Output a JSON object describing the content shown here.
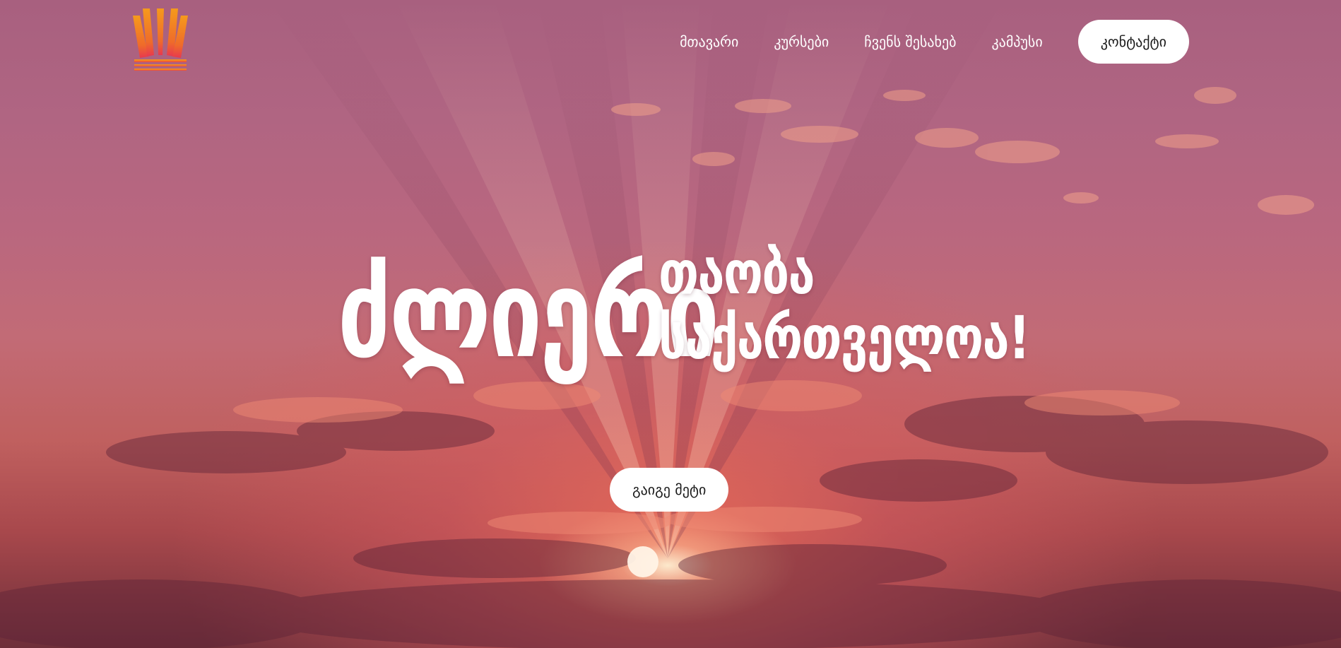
{
  "nav": {
    "items": [
      {
        "label": "მთავარი"
      },
      {
        "label": "კურსები"
      },
      {
        "label": "ჩვენს შესახებ"
      },
      {
        "label": "კამპუსი"
      }
    ],
    "contact_label": "კონტაქტი"
  },
  "hero": {
    "headline_big": "ძლიერი",
    "headline_line1": "თაობა",
    "headline_line2": "საქართველოა!",
    "cta_label": "გაიგე მეტი"
  },
  "colors": {
    "logo_orange": "#f28a1e",
    "logo_red": "#e8384f",
    "button_bg": "#ffffff"
  },
  "icons": {
    "logo": "sunrise-logo-icon"
  }
}
